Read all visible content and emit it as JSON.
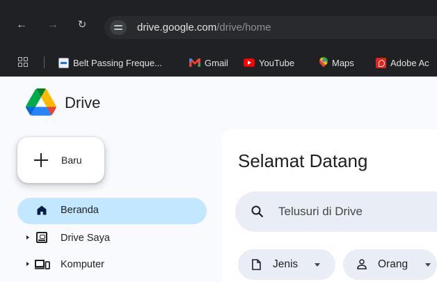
{
  "browser": {
    "url_host": "drive.google.com",
    "url_path": "/drive/home",
    "bookmarks": [
      {
        "label": "Belt Passing Freque...",
        "icon": "belt-doc-icon"
      },
      {
        "label": "Gmail",
        "icon": "gmail-icon"
      },
      {
        "label": "YouTube",
        "icon": "youtube-icon"
      },
      {
        "label": "Maps",
        "icon": "maps-icon"
      },
      {
        "label": "Adobe Ac",
        "icon": "adobe-icon"
      }
    ]
  },
  "drive": {
    "title": "Drive",
    "new_label": "Baru",
    "nav": [
      {
        "label": "Beranda",
        "icon": "home-icon",
        "active": true
      },
      {
        "label": "Drive Saya",
        "icon": "my-drive-icon",
        "active": false
      },
      {
        "label": "Komputer",
        "icon": "computer-icon",
        "active": false
      }
    ],
    "welcome": "Selamat Datang",
    "search_placeholder": "Telusuri di Drive",
    "filters": [
      {
        "label": "Jenis",
        "icon": "document-icon"
      },
      {
        "label": "Orang",
        "icon": "person-icon"
      }
    ]
  },
  "colors": {
    "chrome_bg": "#202124",
    "app_bg": "#f8fafd",
    "active_nav": "#c2e7ff",
    "search_bg": "#e9eef6"
  }
}
